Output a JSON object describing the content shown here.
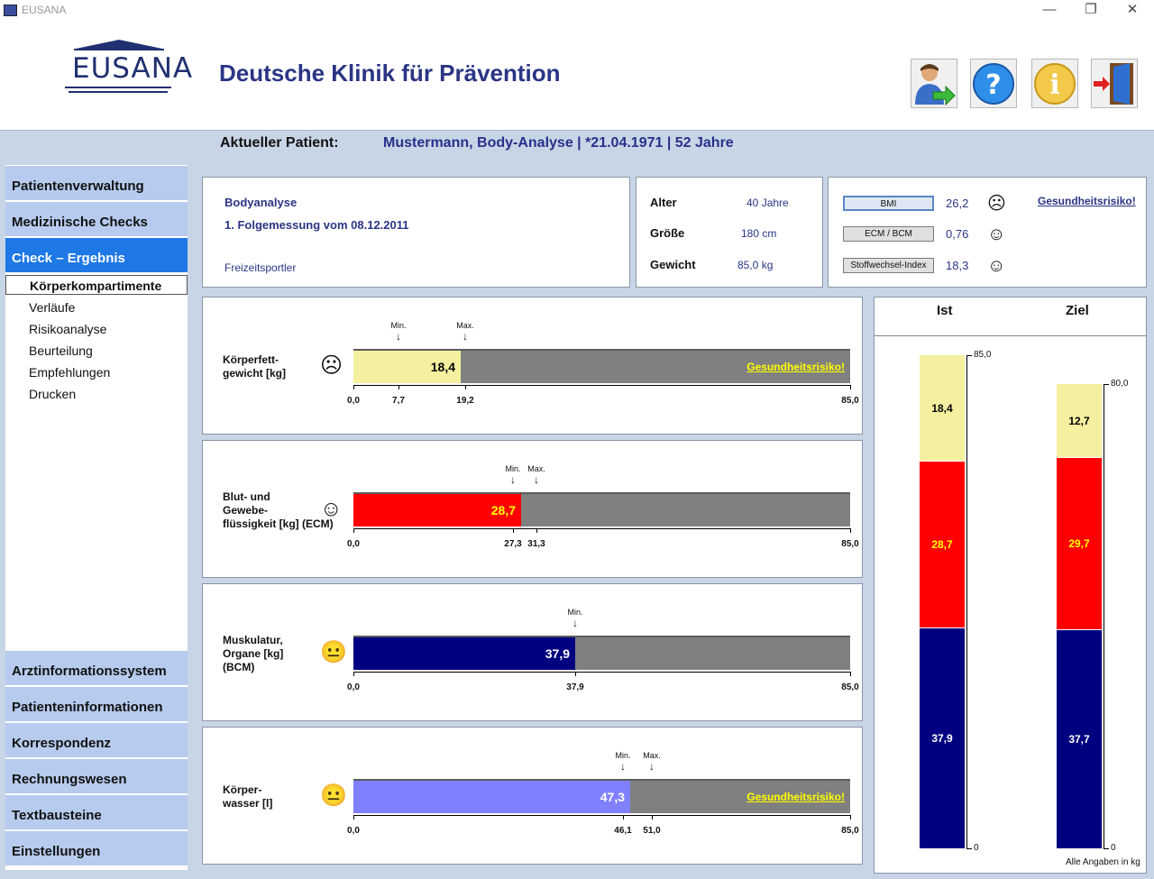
{
  "window": {
    "title": "EUSANA",
    "minimize": "—",
    "restore": "❐",
    "close": "✕"
  },
  "header": {
    "logo": "EUSANA",
    "clinic": "Deutsche Klinik für Prävention",
    "buttons": [
      "patient-switch-icon",
      "help-icon",
      "info-icon",
      "exit-door-icon"
    ]
  },
  "patient": {
    "label": "Aktueller Patient:",
    "value": "Mustermann, Body-Analyse  |  *21.04.1971  |  52 Jahre"
  },
  "nav": {
    "top": [
      "Patientenverwaltung",
      "Medizinische Checks",
      "Check – Ergebnis"
    ],
    "sub": [
      "Körperkompartimente",
      "Verläufe",
      "Risikoanalyse",
      "Beurteilung",
      "Empfehlungen",
      "Drucken"
    ],
    "bottom": [
      "Arztinformationssystem",
      "Patienteninformationen",
      "Korrespondenz",
      "Rechnungswesen",
      "Textbausteine",
      "Einstellungen"
    ]
  },
  "analysis": {
    "title": "Bodyanalyse",
    "measurement": "1. Folgemessung vom 08.12.2011",
    "profile": "Freizeitsportler"
  },
  "stats": {
    "age_label": "Alter",
    "age_value": "40",
    "age_unit": "Jahre",
    "height_label": "Größe",
    "height_value": "180",
    "height_unit": "cm",
    "weight_label": "Gewicht",
    "weight_value": "85,0",
    "weight_unit": "kg"
  },
  "indices": {
    "bmi_label": "BMI",
    "bmi_value": "26,2",
    "bmi_smiley": "☹",
    "ecm_label": "ECM / BCM",
    "ecm_value": "0,76",
    "ecm_smiley": "☺",
    "met_label": "Stoffwechsel-Index",
    "met_value": "18,3",
    "met_smiley": "☺",
    "risk_link": "Gesundheitsrisiko!"
  },
  "rows": [
    {
      "label": "Körperfett-\ngewicht [kg]",
      "smiley": "☹",
      "value": 18.4,
      "value_text": "18,4",
      "fill": "#f5f0a0",
      "text_color": "#000",
      "risk": "Gesundheitsrisiko!",
      "ticks": [
        {
          "v": 0,
          "t": "0,0"
        },
        {
          "v": 7.7,
          "t": "7,7"
        },
        {
          "v": 19.2,
          "t": "19,2"
        },
        {
          "v": 85,
          "t": "85,0"
        }
      ],
      "markers": [
        {
          "v": 7.7,
          "t": "Min."
        },
        {
          "v": 19.2,
          "t": "Max."
        }
      ]
    },
    {
      "label": "Blut- und\nGewebe-\nflüssigkeit [kg] (ECM)",
      "smiley": "☺",
      "value": 28.7,
      "value_text": "28,7",
      "fill": "#ff0000",
      "text_color": "#ffff00",
      "risk": "",
      "ticks": [
        {
          "v": 0,
          "t": "0,0"
        },
        {
          "v": 27.3,
          "t": "27,3"
        },
        {
          "v": 31.3,
          "t": "31,3"
        },
        {
          "v": 85,
          "t": "85,0"
        }
      ],
      "markers": [
        {
          "v": 27.3,
          "t": "Min."
        },
        {
          "v": 31.3,
          "t": "Max."
        }
      ]
    },
    {
      "label": "Muskulatur,\nOrgane [kg]\n(BCM)",
      "smiley": "😐",
      "value": 37.9,
      "value_text": "37,9",
      "fill": "#000080",
      "text_color": "#fff",
      "risk": "",
      "ticks": [
        {
          "v": 0,
          "t": "0,0"
        },
        {
          "v": 37.9,
          "t": "37,9"
        },
        {
          "v": 85,
          "t": "85,0"
        }
      ],
      "markers": [
        {
          "v": 37.9,
          "t": "Min."
        }
      ]
    },
    {
      "label": "Körper-\nwasser [l]",
      "smiley": "😐",
      "value": 47.3,
      "value_text": "47,3",
      "fill": "#8080ff",
      "text_color": "#fff",
      "risk": "Gesundheitsrisiko!",
      "ticks": [
        {
          "v": 0,
          "t": "0,0"
        },
        {
          "v": 46.1,
          "t": "46,1"
        },
        {
          "v": 51,
          "t": "51,0"
        },
        {
          "v": 85,
          "t": "85,0"
        }
      ],
      "markers": [
        {
          "v": 46.1,
          "t": "Min."
        },
        {
          "v": 51,
          "t": "Max."
        }
      ]
    }
  ],
  "columns": {
    "ist_label": "Ist",
    "ziel_label": "Ziel",
    "ist_total": 85.0,
    "ist_total_text": "85,0",
    "ziel_total": 80.0,
    "ziel_total_text": "80,0",
    "zero_text": "0",
    "ist": [
      {
        "v": 18.4,
        "t": "18,4",
        "c": "#f5f0a0",
        "tc": "#000"
      },
      {
        "v": 28.7,
        "t": "28,7",
        "c": "#ff0000",
        "tc": "#ffff00"
      },
      {
        "v": 37.9,
        "t": "37,9",
        "c": "#000080",
        "tc": "#fff"
      }
    ],
    "ziel": [
      {
        "v": 12.7,
        "t": "12,7",
        "c": "#f5f0a0",
        "tc": "#000"
      },
      {
        "v": 29.7,
        "t": "29,7",
        "c": "#ff0000",
        "tc": "#ffff00"
      },
      {
        "v": 37.7,
        "t": "37,7",
        "c": "#000080",
        "tc": "#fff"
      }
    ],
    "footnote": "Alle Angaben in kg"
  }
}
